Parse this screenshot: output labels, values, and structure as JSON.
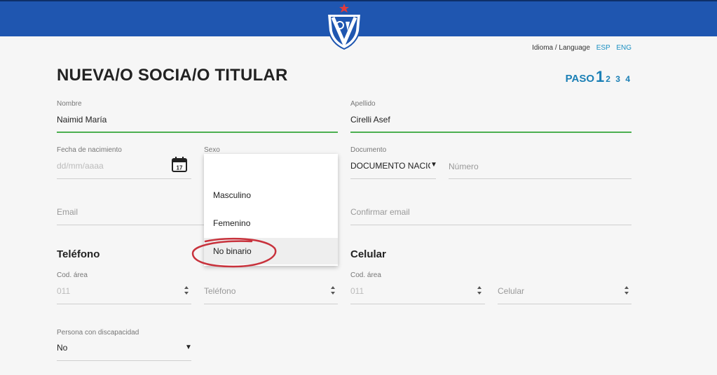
{
  "header": {
    "brand_color": "#1f56b0",
    "logo_icon": "club-crest-icon"
  },
  "language": {
    "label": "Idioma / Language",
    "options": [
      "ESP",
      "ENG"
    ]
  },
  "page": {
    "title": "NUEVA/O SOCIA/O TITULAR",
    "step_label": "PASO",
    "step_current": "1",
    "steps_remaining": "2 3 4"
  },
  "form": {
    "nombre": {
      "label": "Nombre",
      "value": "Naimid María"
    },
    "apellido": {
      "label": "Apellido",
      "value": "Cirelli Asef"
    },
    "fecha": {
      "label": "Fecha de nacimiento",
      "placeholder": "dd/mm/aaaa",
      "calendar_day": "17"
    },
    "sexo": {
      "label": "Sexo",
      "options": [
        "Masculino",
        "Femenino",
        "No binario"
      ],
      "highlighted": "No binario"
    },
    "documento": {
      "label": "Documento",
      "value": "DOCUMENTO NACION"
    },
    "numero": {
      "placeholder": "Número"
    },
    "email": {
      "placeholder": "Email"
    },
    "confirmar_email": {
      "placeholder": "Confirmar email"
    },
    "telefono_section": {
      "title": "Teléfono",
      "cod_label": "Cod. área",
      "cod_placeholder": "011",
      "num_placeholder": "Teléfono"
    },
    "celular_section": {
      "title": "Celular",
      "cod_label": "Cod. área",
      "cod_placeholder": "011",
      "num_placeholder": "Celular"
    },
    "discapacidad": {
      "label": "Persona con discapacidad",
      "value": "No"
    }
  },
  "colors": {
    "accent": "#1a7fb5",
    "active_underline": "#4caf50",
    "annotation": "#c8323c"
  }
}
